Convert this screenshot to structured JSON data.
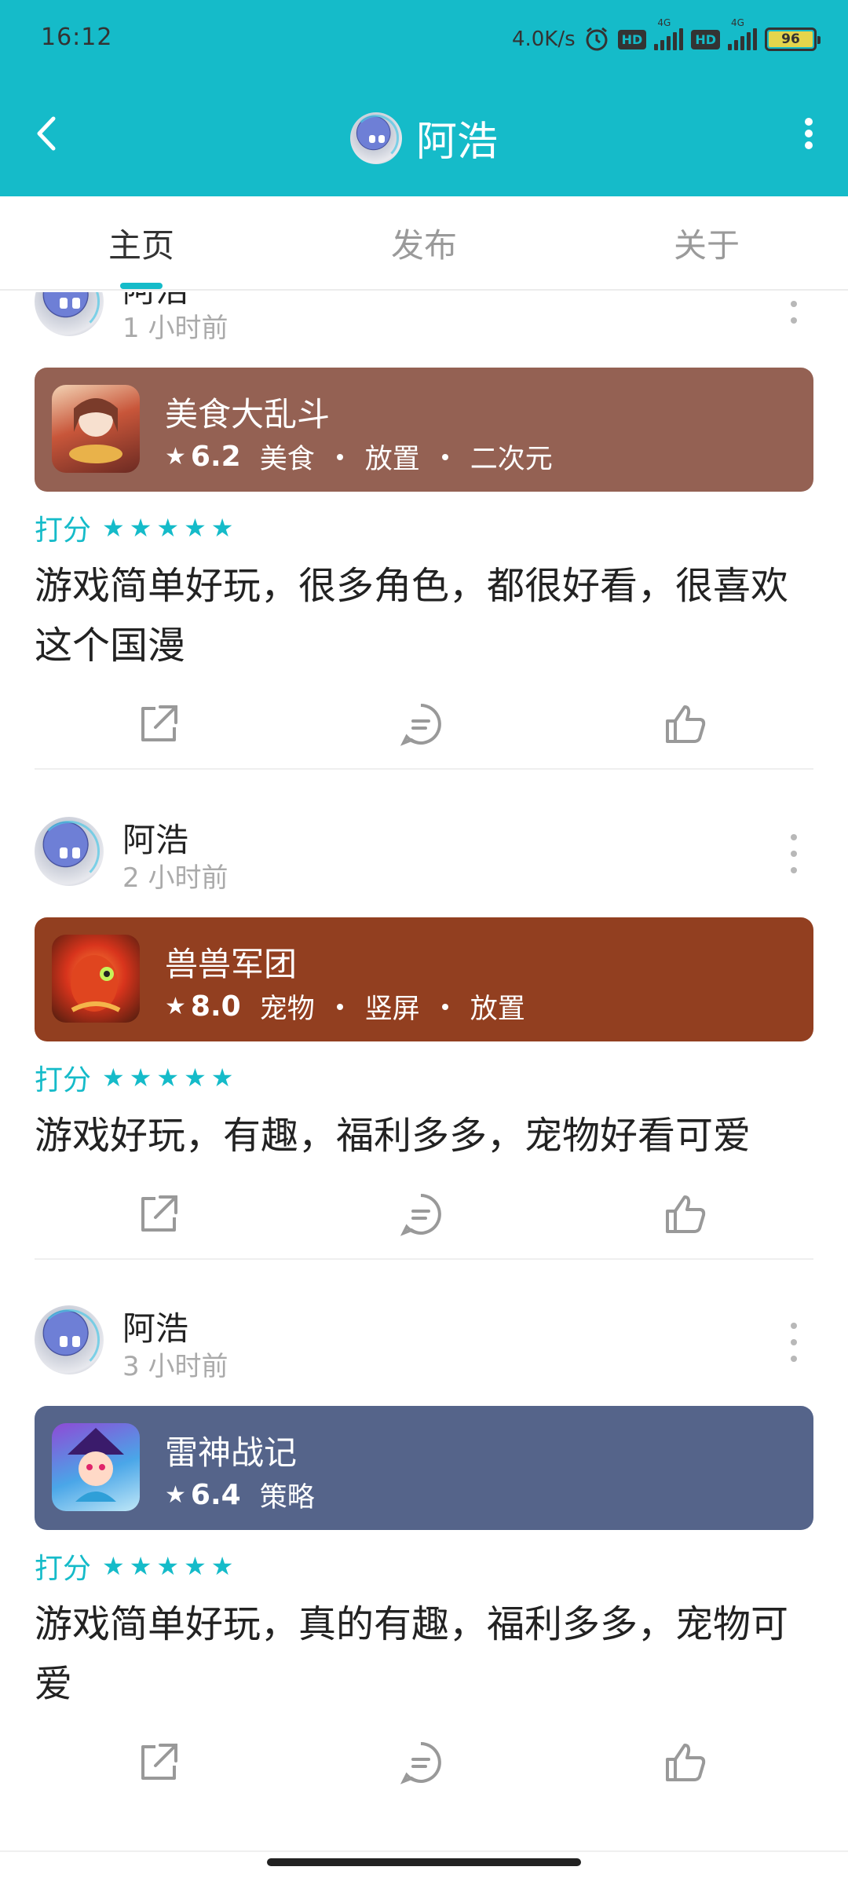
{
  "status_bar": {
    "time": "16:12",
    "net_speed": "4.0K/s",
    "alarm_icon": "alarm-icon",
    "hd1": "HD",
    "hd2": "HD",
    "sig1_label": "4G",
    "sig2_label": "4G",
    "battery": "96"
  },
  "header": {
    "title": "阿浩",
    "back_icon": "back-arrow-icon",
    "more_icon": "more-vertical-icon",
    "bg_color": "#15bbc9"
  },
  "tabs": [
    {
      "label": "主页",
      "active": true
    },
    {
      "label": "发布",
      "active": false
    },
    {
      "label": "关于",
      "active": false
    }
  ],
  "posts": [
    {
      "user": "阿浩",
      "time": "1 小时前",
      "game": {
        "name": "美食大乱斗",
        "score": "6.2",
        "tags": [
          "美食",
          "放置",
          "二次元"
        ],
        "card_color": "#946153"
      },
      "rating_label": "打分",
      "stars": 5,
      "review": "游戏简单好玩，很多角色，都很好看，很喜欢这个国漫"
    },
    {
      "user": "阿浩",
      "time": "2 小时前",
      "game": {
        "name": "兽兽军团",
        "score": "8.0",
        "tags": [
          "宠物",
          "竖屏",
          "放置"
        ],
        "card_color": "#923f20"
      },
      "rating_label": "打分",
      "stars": 5,
      "review": "游戏好玩，有趣，福利多多，宠物好看可爱"
    },
    {
      "user": "阿浩",
      "time": "3 小时前",
      "game": {
        "name": "雷神战记",
        "score": "6.4",
        "tags": [
          "策略"
        ],
        "card_color": "#55648a"
      },
      "rating_label": "打分",
      "stars": 5,
      "review": "游戏简单好玩，真的有趣，福利多多，宠物可爱"
    }
  ],
  "accent_color": "#15bbc9"
}
